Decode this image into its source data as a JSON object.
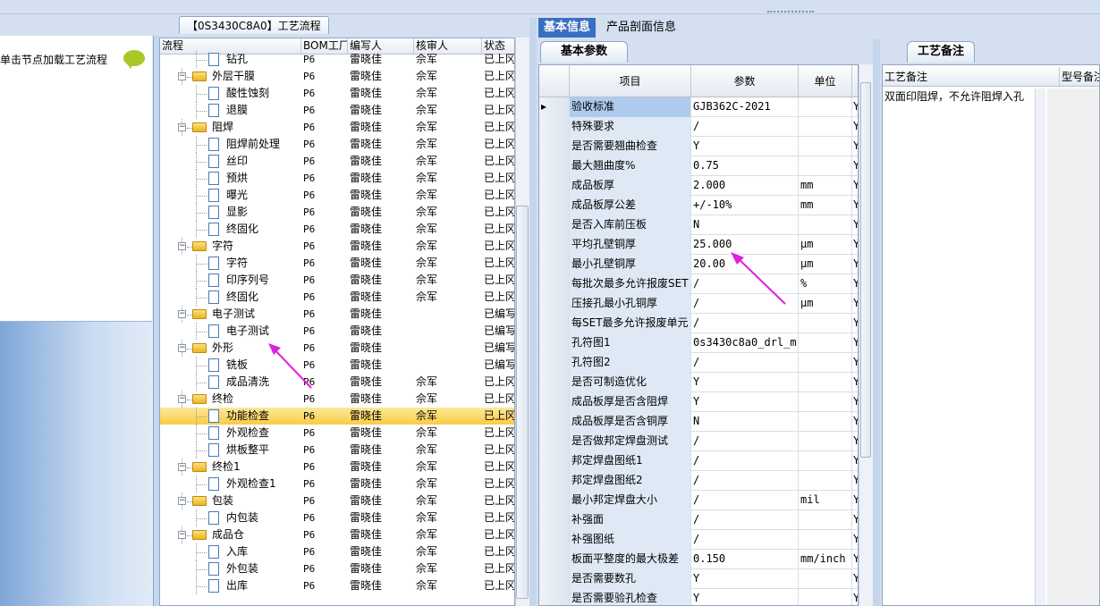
{
  "left": {
    "hint": "单击节点加载工艺流程"
  },
  "tree": {
    "title": "【0S3430C8A0】工艺流程",
    "headers": [
      "流程",
      "BOM工厂",
      "编写人",
      "核审人",
      "状态"
    ],
    "rows": [
      {
        "name": "钻孔",
        "level": 1,
        "type": "doc",
        "bom": "P6",
        "writer": "雷晓佳",
        "reviewer": "佘军",
        "status": "已上冈"
      },
      {
        "name": "外层干膜",
        "level": 0,
        "type": "folder",
        "bom": "P6",
        "writer": "雷晓佳",
        "reviewer": "佘军",
        "status": "已上冈"
      },
      {
        "name": "酸性蚀刻",
        "level": 1,
        "type": "doc",
        "bom": "P6",
        "writer": "雷晓佳",
        "reviewer": "佘军",
        "status": "已上冈"
      },
      {
        "name": "退膜",
        "level": 1,
        "type": "doc",
        "bom": "P6",
        "writer": "雷晓佳",
        "reviewer": "佘军",
        "status": "已上冈"
      },
      {
        "name": "阻焊",
        "level": 0,
        "type": "folder",
        "bom": "P6",
        "writer": "雷晓佳",
        "reviewer": "佘军",
        "status": "已上冈"
      },
      {
        "name": "阻焊前处理",
        "level": 1,
        "type": "doc",
        "bom": "P6",
        "writer": "雷晓佳",
        "reviewer": "佘军",
        "status": "已上冈"
      },
      {
        "name": "丝印",
        "level": 1,
        "type": "doc",
        "bom": "P6",
        "writer": "雷晓佳",
        "reviewer": "佘军",
        "status": "已上冈"
      },
      {
        "name": "预烘",
        "level": 1,
        "type": "doc",
        "bom": "P6",
        "writer": "雷晓佳",
        "reviewer": "佘军",
        "status": "已上冈"
      },
      {
        "name": "曝光",
        "level": 1,
        "type": "doc",
        "bom": "P6",
        "writer": "雷晓佳",
        "reviewer": "佘军",
        "status": "已上冈"
      },
      {
        "name": "显影",
        "level": 1,
        "type": "doc",
        "bom": "P6",
        "writer": "雷晓佳",
        "reviewer": "佘军",
        "status": "已上冈"
      },
      {
        "name": "终固化",
        "level": 1,
        "type": "doc",
        "bom": "P6",
        "writer": "雷晓佳",
        "reviewer": "佘军",
        "status": "已上冈"
      },
      {
        "name": "字符",
        "level": 0,
        "type": "folder",
        "bom": "P6",
        "writer": "雷晓佳",
        "reviewer": "佘军",
        "status": "已上冈"
      },
      {
        "name": "字符",
        "level": 1,
        "type": "doc",
        "bom": "P6",
        "writer": "雷晓佳",
        "reviewer": "佘军",
        "status": "已上冈"
      },
      {
        "name": "印序列号",
        "level": 1,
        "type": "doc",
        "bom": "P6",
        "writer": "雷晓佳",
        "reviewer": "佘军",
        "status": "已上冈"
      },
      {
        "name": "终固化",
        "level": 1,
        "type": "doc",
        "bom": "P6",
        "writer": "雷晓佳",
        "reviewer": "佘军",
        "status": "已上冈"
      },
      {
        "name": "电子测试",
        "level": 0,
        "type": "folder",
        "bom": "P6",
        "writer": "雷晓佳",
        "reviewer": "",
        "status": "已编写"
      },
      {
        "name": "电子测试",
        "level": 1,
        "type": "doc",
        "bom": "P6",
        "writer": "雷晓佳",
        "reviewer": "",
        "status": "已编写"
      },
      {
        "name": "外形",
        "level": 0,
        "type": "folder",
        "bom": "P6",
        "writer": "雷晓佳",
        "reviewer": "",
        "status": "已编写"
      },
      {
        "name": "铣板",
        "level": 1,
        "type": "doc",
        "bom": "P6",
        "writer": "雷晓佳",
        "reviewer": "",
        "status": "已编写"
      },
      {
        "name": "成品清洗",
        "level": 1,
        "type": "doc",
        "bom": "P6",
        "writer": "雷晓佳",
        "reviewer": "佘军",
        "status": "已上冈"
      },
      {
        "name": "终检",
        "level": 0,
        "type": "folder",
        "bom": "P6",
        "writer": "雷晓佳",
        "reviewer": "佘军",
        "status": "已上冈"
      },
      {
        "name": "功能检查",
        "level": 1,
        "type": "doc",
        "bom": "P6",
        "writer": "雷晓佳",
        "reviewer": "佘军",
        "status": "已上冈",
        "selected": true
      },
      {
        "name": "外观检查",
        "level": 1,
        "type": "doc",
        "bom": "P6",
        "writer": "雷晓佳",
        "reviewer": "佘军",
        "status": "已上冈"
      },
      {
        "name": "烘板整平",
        "level": 1,
        "type": "doc",
        "bom": "P6",
        "writer": "雷晓佳",
        "reviewer": "佘军",
        "status": "已上冈"
      },
      {
        "name": "终检1",
        "level": 0,
        "type": "folder",
        "bom": "P6",
        "writer": "雷晓佳",
        "reviewer": "佘军",
        "status": "已上冈"
      },
      {
        "name": "外观检查1",
        "level": 1,
        "type": "doc",
        "bom": "P6",
        "writer": "雷晓佳",
        "reviewer": "佘军",
        "status": "已上冈"
      },
      {
        "name": "包装",
        "level": 0,
        "type": "folder",
        "bom": "P6",
        "writer": "雷晓佳",
        "reviewer": "佘军",
        "status": "已上冈"
      },
      {
        "name": "内包装",
        "level": 1,
        "type": "doc",
        "bom": "P6",
        "writer": "雷晓佳",
        "reviewer": "佘军",
        "status": "已上冈"
      },
      {
        "name": "成品仓",
        "level": 0,
        "type": "folder",
        "bom": "P6",
        "writer": "雷晓佳",
        "reviewer": "佘军",
        "status": "已上冈"
      },
      {
        "name": "入库",
        "level": 1,
        "type": "doc",
        "bom": "P6",
        "writer": "雷晓佳",
        "reviewer": "佘军",
        "status": "已上冈"
      },
      {
        "name": "外包装",
        "level": 1,
        "type": "doc",
        "bom": "P6",
        "writer": "雷晓佳",
        "reviewer": "佘军",
        "status": "已上冈"
      },
      {
        "name": "出库",
        "level": 1,
        "type": "doc",
        "bom": "P6",
        "writer": "雷晓佳",
        "reviewer": "佘军",
        "status": "已上冈"
      }
    ]
  },
  "tabs": {
    "basic": "基本信息",
    "profile": "产品剖面信息",
    "params": "基本参数",
    "notes": "工艺备注"
  },
  "params": {
    "headers": [
      "项目",
      "参数",
      "单位"
    ],
    "rows": [
      {
        "item": "验收标准",
        "value": "GJB362C-2021",
        "unit": "",
        "flag": "Y",
        "current": true
      },
      {
        "item": "特殊要求",
        "value": "/",
        "unit": "",
        "flag": "Y"
      },
      {
        "item": "是否需要翘曲检查",
        "value": "Y",
        "unit": "",
        "flag": "Y"
      },
      {
        "item": "最大翘曲度%",
        "value": "0.75",
        "unit": "",
        "flag": "Y"
      },
      {
        "item": "成品板厚",
        "value": "2.000",
        "unit": "mm",
        "flag": "Y"
      },
      {
        "item": "成品板厚公差",
        "value": "+/-10%",
        "unit": "mm",
        "flag": "Y"
      },
      {
        "item": "是否入库前压板",
        "value": "N",
        "unit": "",
        "flag": "Y"
      },
      {
        "item": "平均孔壁铜厚",
        "value": "25.000",
        "unit": "μm",
        "flag": "Y"
      },
      {
        "item": "最小孔壁铜厚",
        "value": "20.00",
        "unit": "μm",
        "flag": "Y"
      },
      {
        "item": "每批次最多允许报废SET",
        "value": "/",
        "unit": "%",
        "flag": "Y"
      },
      {
        "item": "压接孔最小孔铜厚",
        "value": "/",
        "unit": "μm",
        "flag": "Y"
      },
      {
        "item": "每SET最多允许报废单元",
        "value": "/",
        "unit": "",
        "flag": "Y"
      },
      {
        "item": "孔符图1",
        "value": "0s3430c8a0_drl_m...",
        "unit": "",
        "flag": "Y"
      },
      {
        "item": "孔符图2",
        "value": "/",
        "unit": "",
        "flag": "Y"
      },
      {
        "item": "是否可制造优化",
        "value": "Y",
        "unit": "",
        "flag": "Y"
      },
      {
        "item": "成品板厚是否含阻焊",
        "value": "Y",
        "unit": "",
        "flag": "Y"
      },
      {
        "item": "成品板厚是否含铜厚",
        "value": "N",
        "unit": "",
        "flag": "Y"
      },
      {
        "item": "是否做邦定焊盘测试",
        "value": "/",
        "unit": "",
        "flag": "Y"
      },
      {
        "item": "邦定焊盘图纸1",
        "value": "/",
        "unit": "",
        "flag": "Y"
      },
      {
        "item": "邦定焊盘图纸2",
        "value": "/",
        "unit": "",
        "flag": "Y"
      },
      {
        "item": "最小邦定焊盘大小",
        "value": "/",
        "unit": "mil",
        "flag": "Y"
      },
      {
        "item": "补强面",
        "value": "/",
        "unit": "",
        "flag": "Y"
      },
      {
        "item": "补强图纸",
        "value": "/",
        "unit": "",
        "flag": "Y"
      },
      {
        "item": "板面平整度的最大极差",
        "value": "0.150",
        "unit": "mm/inch",
        "flag": "Y"
      },
      {
        "item": "是否需要数孔",
        "value": "Y",
        "unit": "",
        "flag": "Y"
      },
      {
        "item": "是否需要验孔检查",
        "value": "Y",
        "unit": "",
        "flag": "Y"
      }
    ]
  },
  "notes": {
    "headers": [
      "工艺备注",
      "型号备注"
    ],
    "text": "双面印阻焊，不允许阻焊入孔"
  },
  "colors": {
    "accent_tab": "#3a6fbf",
    "selection": "#f9cc46",
    "annotation_arrow": "#e020e0"
  }
}
